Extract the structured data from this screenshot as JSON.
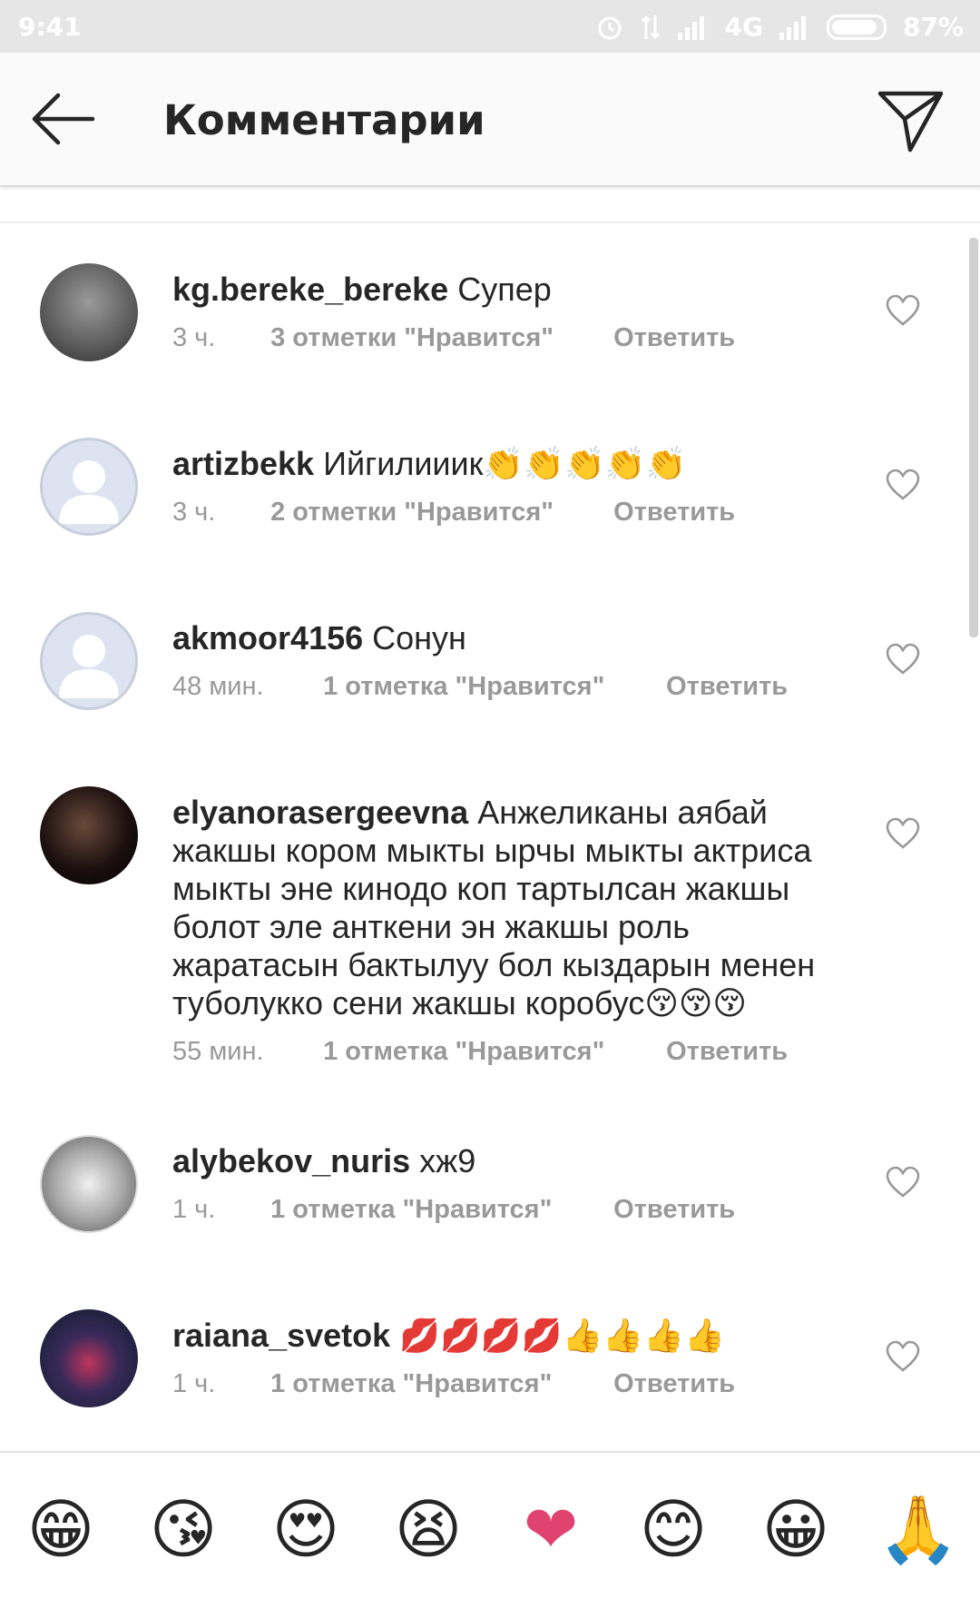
{
  "status_bar": {
    "time": "9:41",
    "network": "4G",
    "battery": "87%"
  },
  "header": {
    "title": "Комментарии"
  },
  "comments": [
    {
      "username": "kg.bereke_bereke",
      "text": "Супер",
      "time": "3 ч.",
      "likes": "3 отметки \"Нравится\"",
      "reply": "Ответить"
    },
    {
      "username": "artizbekk",
      "text": "Ийгилииик👏👏👏👏👏",
      "time": "3 ч.",
      "likes": "2 отметки \"Нравится\"",
      "reply": "Ответить"
    },
    {
      "username": "akmoor4156",
      "text": "Сонун",
      "time": "48 мин.",
      "likes": "1 отметка \"Нравится\"",
      "reply": "Ответить"
    },
    {
      "username": "elyanorasergeevna",
      "text": "Анжеликаны аябай жакшы кором мыкты ырчы мыкты актриса мыкты эне кинодо коп тартылсан жакшы болот эле анткени эн жакшы роль жаратасын бактылуу бол кыздарын менен туболукко сени жакшы коробус😚😚😚",
      "time": "55 мин.",
      "likes": "1 отметка \"Нравится\"",
      "reply": "Ответить"
    },
    {
      "username": "alybekov_nuris",
      "text": "хж9",
      "time": "1 ч.",
      "likes": "1 отметка \"Нравится\"",
      "reply": "Ответить"
    },
    {
      "username": "raiana_svetok",
      "text": "💋💋💋💋👍👍👍👍",
      "time": "1 ч.",
      "likes": "1 отметка \"Нравится\"",
      "reply": "Ответить"
    }
  ],
  "emoji_bar": [
    "😁",
    "😘",
    "😍",
    "😫",
    "❤",
    "😊",
    "😀",
    "🙏"
  ],
  "icons": {
    "back": "arrow-left-icon",
    "send": "send-icon",
    "like": "heart-outline-icon"
  }
}
